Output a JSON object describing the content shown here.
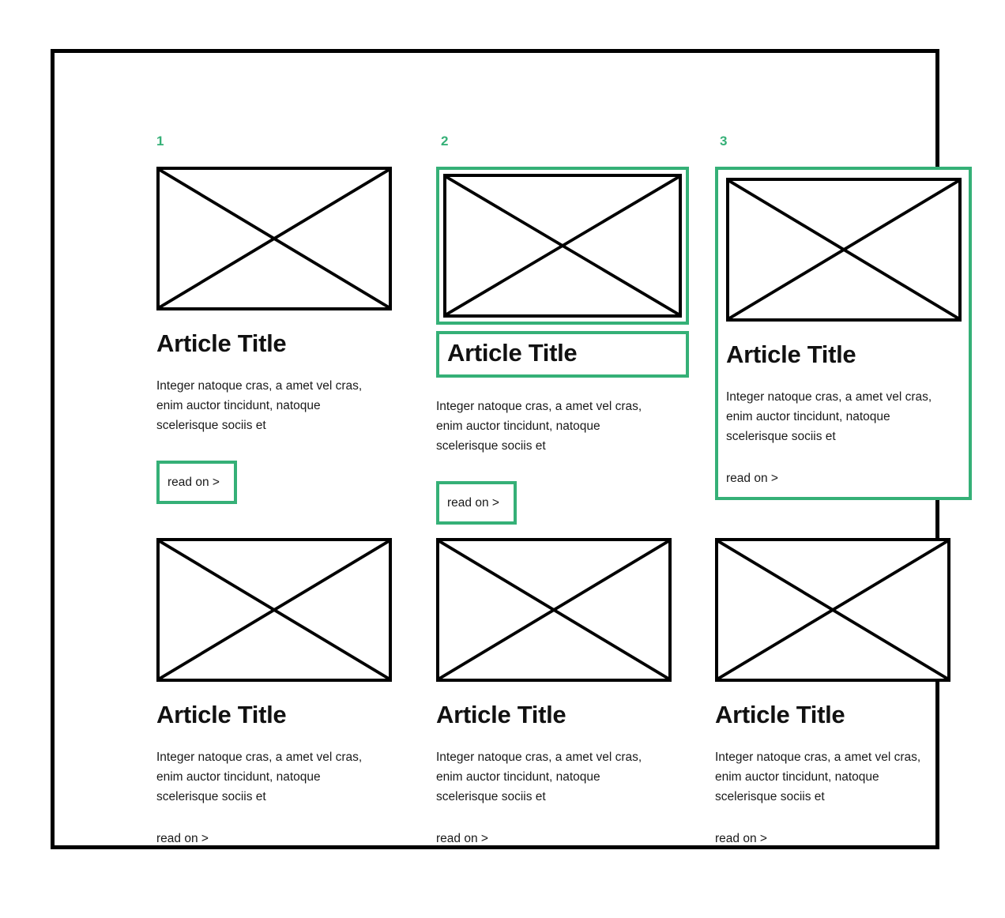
{
  "theme": {
    "accent": "#35b077",
    "ink": "#000000",
    "background": "#ffffff"
  },
  "wireframe": {
    "frame_label": "article-grid-wireframe",
    "columns": 3,
    "rows": 2
  },
  "annotations": {
    "numbers": [
      "1",
      "2",
      "3"
    ],
    "descriptions": [
      "read on link highlighted",
      "thumbnail, title and read on link highlighted separately",
      "whole card highlighted"
    ]
  },
  "article": {
    "title": "Article Title",
    "body": "Integer natoque cras, a amet vel cras, enim auctor tincidunt, natoque scelerisque sociis et",
    "read_more": "read on >",
    "thumbnail_alt": "image placeholder"
  },
  "cards": [
    {
      "number": "1",
      "title": "Article Title",
      "body": "Integer natoque cras, a amet vel cras, enim auctor tincidunt, natoque scelerisque sociis et",
      "read_more": "read on >",
      "highlight": "read-on"
    },
    {
      "number": "2",
      "title": "Article Title",
      "body": "Integer natoque cras, a amet vel cras, enim auctor tincidunt, natoque scelerisque sociis et",
      "read_more": "read on >",
      "highlight": "thumb-title-readon"
    },
    {
      "number": "3",
      "title": "Article Title",
      "body": "Integer natoque cras, a amet vel cras, enim auctor tincidunt, natoque scelerisque sociis et",
      "read_more": "read on >",
      "highlight": "whole-card"
    },
    {
      "number": "",
      "title": "Article Title",
      "body": "Integer natoque cras, a amet vel cras, enim auctor tincidunt, natoque scelerisque sociis et",
      "read_more": "read on >",
      "highlight": "none"
    },
    {
      "number": "",
      "title": "Article Title",
      "body": "Integer natoque cras, a amet vel cras, enim auctor tincidunt, natoque scelerisque sociis et",
      "read_more": "read on >",
      "highlight": "none"
    },
    {
      "number": "",
      "title": "Article Title",
      "body": "Integer natoque cras, a amet vel cras, enim auctor tincidunt, natoque scelerisque sociis et",
      "read_more": "read on >",
      "highlight": "none"
    }
  ]
}
